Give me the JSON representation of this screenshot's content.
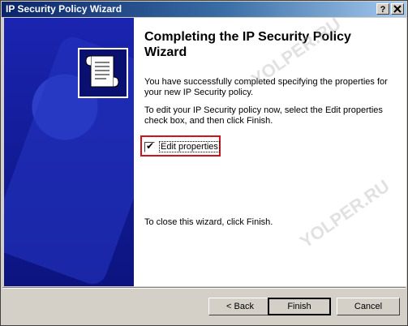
{
  "window": {
    "title": "IP Security Policy Wizard",
    "help_button": "?",
    "close_button": "x"
  },
  "content": {
    "heading": "Completing the IP Security Policy Wizard",
    "paragraph1": "You have successfully completed specifying the properties for your new IP Security policy.",
    "paragraph2": "To edit your IP Security policy now, select the Edit properties check box, and then click Finish.",
    "checkbox": {
      "label": "Edit properties",
      "checked": true
    },
    "paragraph3": "To close this wizard, click Finish."
  },
  "buttons": {
    "back": "< Back",
    "finish": "Finish",
    "cancel": "Cancel"
  },
  "watermark": "YOLPER.RU",
  "colors": {
    "titlebar_start": "#0a246a",
    "side_panel": "#0f1896",
    "highlight": "#d0121b"
  }
}
